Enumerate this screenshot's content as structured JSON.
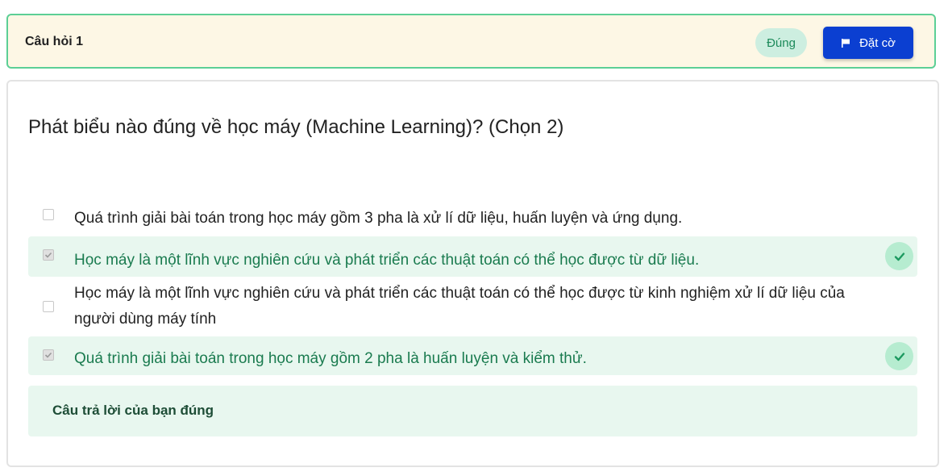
{
  "header": {
    "title": "Câu hỏi 1",
    "status": "Đúng",
    "flag_label": "Đặt cờ",
    "flag_icon": "flag-icon"
  },
  "question": {
    "text": "Phát biểu nào đúng về học máy (Machine Learning)? (Chọn 2)"
  },
  "options": [
    {
      "text": "Quá trình giải bài toán trong học máy gồm 3 pha là xử lí dữ liệu, huấn luyện và ứng dụng.",
      "checked": false,
      "correct": false
    },
    {
      "text": "Học máy là một lĩnh vực nghiên cứu và phát triển các thuật toán có thể học được từ dữ liệu.",
      "checked": true,
      "correct": true
    },
    {
      "text_line1": "Học máy là một lĩnh vực nghiên cứu và phát triển các thuật toán có thể học được từ kinh nghiệm xử lí dữ liệu của",
      "text_line2": "người dùng máy tính",
      "checked": false,
      "correct": false
    },
    {
      "text": "Quá trình giải bài toán trong học máy gồm 2 pha là huấn luyện và kiểm thử.",
      "checked": true,
      "correct": true
    }
  ],
  "feedback": {
    "text": "Câu trả lời của bạn đúng"
  },
  "colors": {
    "header_bg": "#fdf7e5",
    "header_border": "#5ccf96",
    "flag_button": "#0b3fd1",
    "correct_bg": "#e8f7ef",
    "correct_text": "#1a7b4f",
    "check_circle": "#b6ecd0"
  }
}
